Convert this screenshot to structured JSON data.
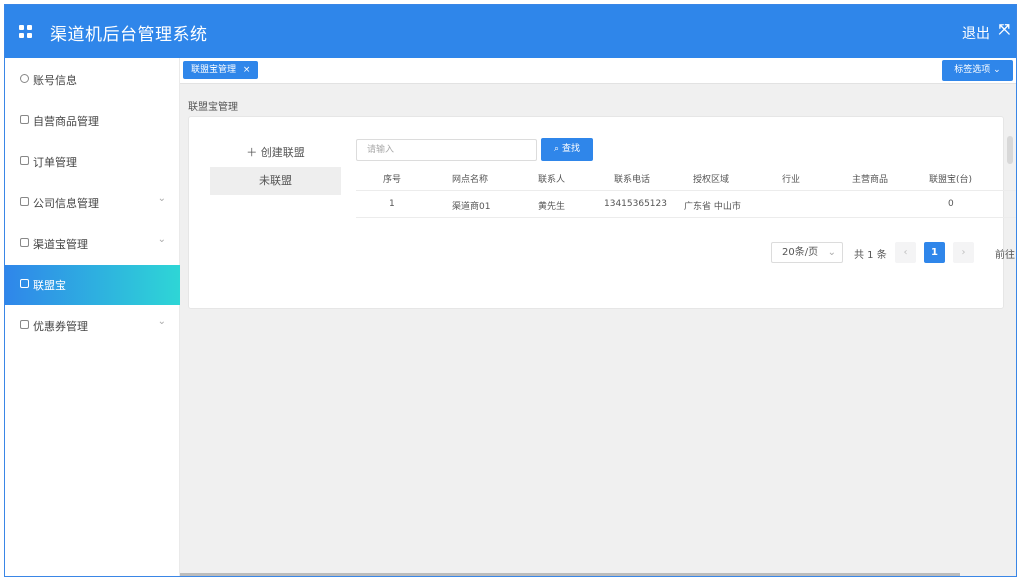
{
  "app": {
    "title": "渠道机后台管理系统",
    "logout_label": "退出",
    "expand_icon": "expand-icon"
  },
  "sidebar": {
    "items": [
      {
        "label": "账号信息",
        "icon": "user-circle-icon",
        "has_chevron": false,
        "active": false
      },
      {
        "label": "自营商品管理",
        "icon": "mail-icon",
        "has_chevron": false,
        "active": false
      },
      {
        "label": "订单管理",
        "icon": "list-icon",
        "has_chevron": false,
        "active": false
      },
      {
        "label": "公司信息管理",
        "icon": "building-icon",
        "has_chevron": true,
        "active": false
      },
      {
        "label": "渠道宝管理",
        "icon": "monitor-icon",
        "has_chevron": true,
        "active": false
      },
      {
        "label": "联盟宝",
        "icon": "monitor-icon",
        "has_chevron": false,
        "active": true
      },
      {
        "label": "优惠券管理",
        "icon": "monitor-icon",
        "has_chevron": true,
        "active": false
      }
    ]
  },
  "tags": {
    "active_tag": "联盟宝管理",
    "close_icon": "×",
    "options_label": "标签选项"
  },
  "page": {
    "heading": "联盟宝管理"
  },
  "left_panel": {
    "create_label": "＋ 创建联盟",
    "not_joined_label": "未联盟"
  },
  "search": {
    "placeholder": "请输入",
    "button_label": "查找"
  },
  "table": {
    "headers": [
      "序号",
      "网点名称",
      "联系人",
      "联系电话",
      "授权区域",
      "行业",
      "主营商品",
      "联盟宝(台)"
    ],
    "rows": [
      [
        "1",
        "渠道商01",
        "黄先生",
        "13415365123",
        "广东省 中山市",
        "",
        "",
        "0"
      ]
    ]
  },
  "pagination": {
    "page_size": "20条/页",
    "total": "共 1 条",
    "current_page": "1",
    "goto_label": "前往"
  },
  "colors": {
    "primary": "#2f86ea",
    "active_gradient_end": "#2ed6d6"
  }
}
